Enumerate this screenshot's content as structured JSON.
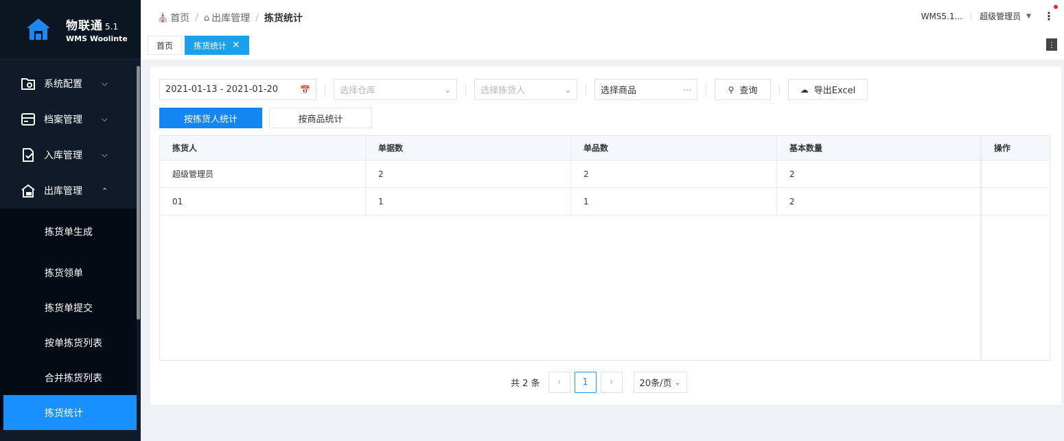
{
  "app": {
    "name": "物联通",
    "version": "5.1",
    "subtitle": "WMS Woolinte"
  },
  "sidebar": {
    "menus": [
      {
        "label": "系统配置",
        "icon": "system-config-icon",
        "expanded": false
      },
      {
        "label": "档案管理",
        "icon": "archive-icon",
        "expanded": false
      },
      {
        "label": "入库管理",
        "icon": "inbound-icon",
        "expanded": false
      },
      {
        "label": "出库管理",
        "icon": "outbound-icon",
        "expanded": true
      }
    ],
    "submenu": [
      {
        "label": "拣货单生成"
      },
      {
        "label": "拣货领单"
      },
      {
        "label": "拣货单提交"
      },
      {
        "label": "按单拣货列表"
      },
      {
        "label": "合并拣货列表"
      },
      {
        "label": "拣货统计",
        "active": true
      }
    ]
  },
  "header": {
    "breadcrumb": [
      "首页",
      "出库管理",
      "拣货统计"
    ],
    "system": "WMS5.1...",
    "user": "超级管理员",
    "tabs": [
      {
        "label": "首页",
        "active": false
      },
      {
        "label": "拣货统计",
        "active": true
      }
    ]
  },
  "filters": {
    "date_range": "2021-01-13 - 2021-01-20",
    "warehouse_placeholder": "选择仓库",
    "picker_placeholder": "选择拣货人",
    "product_value": "选择商品",
    "query_label": "查询",
    "export_label": "导出Excel"
  },
  "modes": [
    "按拣货人统计",
    "按商品统计"
  ],
  "table": {
    "headers": [
      "拣货人",
      "单据数",
      "单品数",
      "基本数量",
      "操作"
    ],
    "rows": [
      [
        "超级管理员",
        "2",
        "2",
        "2",
        ""
      ],
      [
        "01",
        "1",
        "1",
        "2",
        ""
      ]
    ]
  },
  "pagination": {
    "total_text": "共 2 条",
    "current_page": "1",
    "page_size": "20条/页"
  },
  "colors": {
    "primary": "#1890ff",
    "sidebar_bg": "#101a29",
    "active_tab": "#1aa1ee"
  }
}
